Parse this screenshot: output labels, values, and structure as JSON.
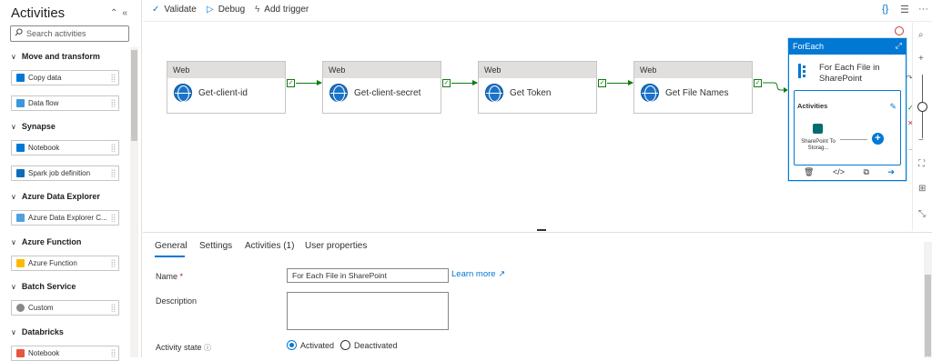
{
  "sidebar": {
    "title": "Activities",
    "search_placeholder": "Search activities",
    "categories": [
      {
        "label": "Move and transform",
        "items": [
          "Copy data",
          "Data flow"
        ]
      },
      {
        "label": "Synapse",
        "items": [
          "Notebook",
          "Spark job definition"
        ]
      },
      {
        "label": "Azure Data Explorer",
        "items": [
          "Azure Data Explorer C..."
        ]
      },
      {
        "label": "Azure Function",
        "items": [
          "Azure Function"
        ]
      },
      {
        "label": "Batch Service",
        "items": [
          "Custom"
        ]
      },
      {
        "label": "Databricks",
        "items": [
          "Notebook"
        ]
      }
    ]
  },
  "toolbar": {
    "validate": "Validate",
    "debug": "Debug",
    "add_trigger": "Add trigger"
  },
  "canvas": {
    "nodes": [
      {
        "type": "Web",
        "label": "Get-client-id"
      },
      {
        "type": "Web",
        "label": "Get-client-secret"
      },
      {
        "type": "Web",
        "label": "Get Token"
      },
      {
        "type": "Web",
        "label": "Get File Names"
      }
    ],
    "foreach": {
      "header": "ForEach",
      "title": "For Each File in SharePoint",
      "inner_header": "Activities",
      "inner_activity": "SharePoint To Storag..."
    }
  },
  "properties": {
    "tabs": [
      "General",
      "Settings",
      "Activities (1)",
      "User properties"
    ],
    "active_tab": "General",
    "name_label": "Name",
    "name_required_mark": "*",
    "name_value": "For Each File in SharePoint",
    "learn_more": "Learn more",
    "description_label": "Description",
    "description_value": "",
    "activity_state_label": "Activity state",
    "state_options": [
      "Activated",
      "Deactivated"
    ],
    "state_selected": "Activated"
  },
  "colors": {
    "accent": "#0078d4",
    "success": "#107c10",
    "error": "#d13438"
  }
}
